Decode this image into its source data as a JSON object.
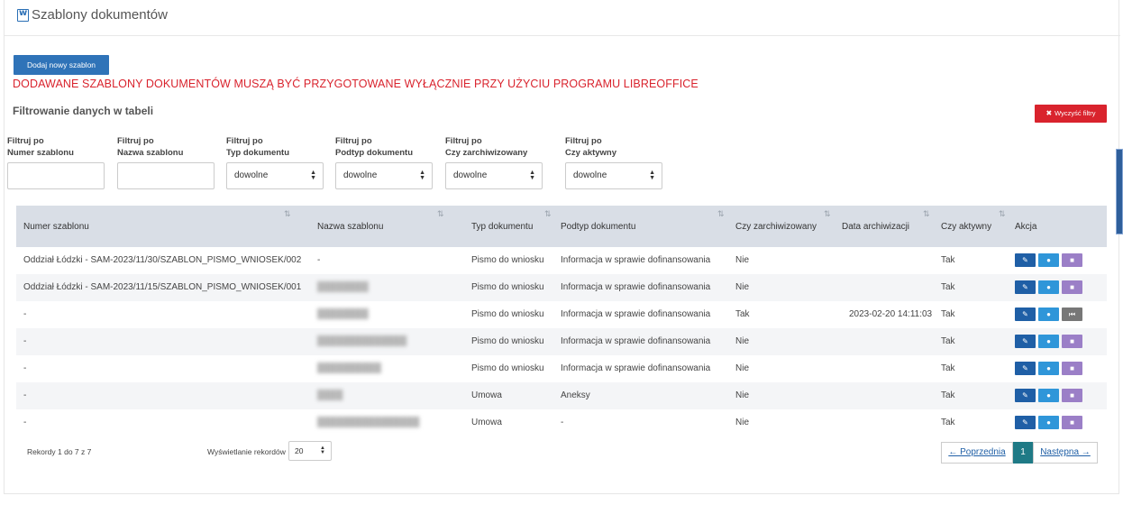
{
  "header": {
    "title": "Szablony dokumentów",
    "icon": "word-document-icon"
  },
  "add_button": "Dodaj nowy szablon",
  "warning": "DODAWANE SZABLONY DOKUMENTÓW MUSZĄ BYĆ PRZYGOTOWANE WYŁĄCZNIE PRZY UŻYCIU PROGRAMU LIBREOFFICE",
  "filter_heading": "Filtrowanie danych w tabeli",
  "clear_filters": "Wyczyść filtry",
  "filters": [
    {
      "line1": "Filtruj po",
      "line2": "Numer szablonu",
      "type": "text",
      "value": ""
    },
    {
      "line1": "Filtruj po",
      "line2": "Nazwa szablonu",
      "type": "text",
      "value": ""
    },
    {
      "line1": "Filtruj po",
      "line2": "Typ dokumentu",
      "type": "select",
      "value": "dowolne"
    },
    {
      "line1": "Filtruj po",
      "line2": "Podtyp dokumentu",
      "type": "select",
      "value": "dowolne"
    },
    {
      "line1": "Filtruj po",
      "line2": "Czy zarchiwizowany",
      "type": "select",
      "value": "dowolne"
    },
    {
      "line1": "Filtruj po",
      "line2": "Czy aktywny",
      "type": "select",
      "value": "dowolne"
    }
  ],
  "columns": [
    "Numer szablonu",
    "Nazwa szablonu",
    "Typ dokumentu",
    "Podtyp dokumentu",
    "Czy zarchiwizowany",
    "Data archiwizacji",
    "Czy aktywny",
    "Akcja"
  ],
  "rows": [
    {
      "numer": "Oddział Łódzki - SAM-2023/11/30/SZABLON_PISMO_WNIOSEK/002",
      "nazwa": "-",
      "nazwa_blurred": false,
      "typ": "Pismo do wniosku",
      "podtyp": "Informacja w sprawie dofinansowania",
      "zarch": "Nie",
      "data": "",
      "aktywny": "Tak",
      "archived": false
    },
    {
      "numer": "Oddział Łódzki - SAM-2023/11/15/SZABLON_PISMO_WNIOSEK/001",
      "nazwa": "████████",
      "nazwa_blurred": true,
      "typ": "Pismo do wniosku",
      "podtyp": "Informacja w sprawie dofinansowania",
      "zarch": "Nie",
      "data": "",
      "aktywny": "Tak",
      "archived": false
    },
    {
      "numer": "-",
      "nazwa": "████████",
      "nazwa_blurred": true,
      "typ": "Pismo do wniosku",
      "podtyp": "Informacja w sprawie dofinansowania",
      "zarch": "Tak",
      "data": "2023-02-20 14:11:03",
      "aktywny": "Tak",
      "archived": true
    },
    {
      "numer": "-",
      "nazwa": "██████████████",
      "nazwa_blurred": true,
      "typ": "Pismo do wniosku",
      "podtyp": "Informacja w sprawie dofinansowania",
      "zarch": "Nie",
      "data": "",
      "aktywny": "Tak",
      "archived": false
    },
    {
      "numer": "-",
      "nazwa": "██████████",
      "nazwa_blurred": true,
      "typ": "Pismo do wniosku",
      "podtyp": "Informacja w sprawie dofinansowania",
      "zarch": "Nie",
      "data": "",
      "aktywny": "Tak",
      "archived": false
    },
    {
      "numer": "-",
      "nazwa": "████",
      "nazwa_blurred": true,
      "typ": "Umowa",
      "podtyp": "Aneksy",
      "zarch": "Nie",
      "data": "",
      "aktywny": "Tak",
      "archived": false
    },
    {
      "numer": "-",
      "nazwa": "████████████████",
      "nazwa_blurred": true,
      "typ": "Umowa",
      "podtyp": "-",
      "zarch": "Nie",
      "data": "",
      "aktywny": "Tak",
      "archived": false
    }
  ],
  "footer": {
    "records": "Rekordy 1 do 7 z 7",
    "per_page_label": "Wyświetlanie rekordów",
    "per_page_value": "20",
    "prev": "← Poprzednia",
    "current_page": "1",
    "next": "Następna →"
  },
  "colors": {
    "primary": "#2f73b8",
    "danger": "#d9232d",
    "header_bg": "#d9dee6",
    "active_page": "#1f7a86"
  }
}
